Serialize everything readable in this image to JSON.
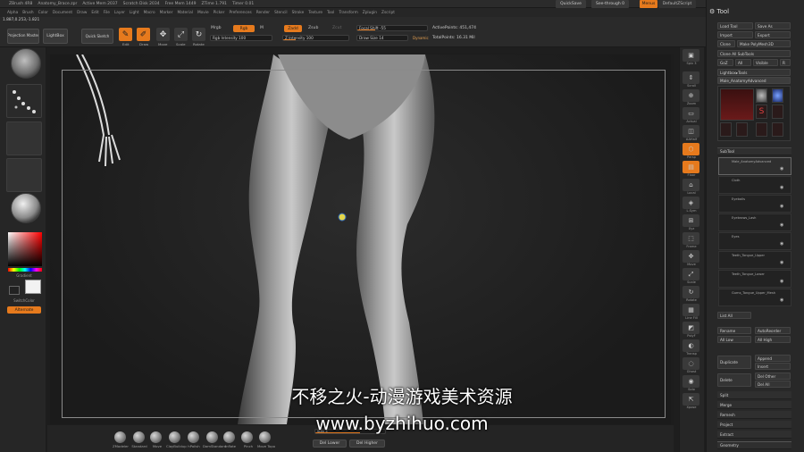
{
  "titlebar": {
    "app": "ZBrush 4R8",
    "doc": "Anatomy_Brace.zpr",
    "stats": [
      "Active Mem 2037",
      "Scratch Disk 2034",
      "Free Mem 1449",
      "ZTime 1.791",
      "Timer 0.01"
    ]
  },
  "topright": {
    "quicksave": "QuickSave",
    "seethrough": "See-through 0",
    "menus": "Menus",
    "script": "DefaultZScript"
  },
  "menubar": [
    "Alpha",
    "Brush",
    "Color",
    "Document",
    "Draw",
    "Edit",
    "File",
    "Layer",
    "Light",
    "Macro",
    "Marker",
    "Material",
    "Movie",
    "Picker",
    "Preferences",
    "Render",
    "Stencil",
    "Stroke",
    "Texture",
    "Tool",
    "Transform",
    "Zplugin",
    "Zscript"
  ],
  "coords": "1.887,0.253,-1.821",
  "toolbar": {
    "projection_master": "Projection Master",
    "lightbox": "LightBox",
    "quick_sketch": "Quick Sketch",
    "edit": "Edit",
    "draw": "Draw",
    "move": "Move",
    "scale": "Scale",
    "rotate": "Rotate",
    "mrgb": "Mrgb",
    "rgb": "Rgb",
    "m": "M",
    "zadd": "Zadd",
    "zsub": "Zsub",
    "zcut": "Zcut",
    "rgb_intensity": "Rgb Intensity 100",
    "z_intensity": "Z Intensity 100",
    "focal_shift": "Focal Shift -55",
    "draw_size": "Draw Size 14",
    "dynamic": "Dynamic",
    "active_points": "ActivePoints: 451,474",
    "total_points": "TotalPoints: 16.31 Mil"
  },
  "lefttray": {
    "labels": [
      "",
      "",
      "",
      "",
      "",
      "Gradient",
      "SwitchColor",
      "Alternate"
    ]
  },
  "subtitle": "不移之火-动漫游戏美术资源",
  "watermark": "www.byzhihuo.com",
  "bottom": {
    "brushes": [
      "ZModeler",
      "Standard",
      "Move",
      "ClayBuildup",
      "hPolish",
      "DamStandard",
      "Inflate",
      "Pinch",
      "Move Topo",
      "Clay"
    ],
    "del_lower": "Del Lower",
    "del_higher": "Del Higher",
    "subdiv": "SDiv 5"
  },
  "rightshelf": [
    "Spix 3",
    "Scroll",
    "Zoom",
    "Actual",
    "AAHalf",
    "Persp",
    "Floor",
    "Local",
    "L.Sym",
    "Xyz",
    "Frame",
    "Move",
    "Scale",
    "Rotate",
    "Line Fill",
    "PolyF",
    "Transp",
    "Ghost",
    "Solo",
    "Xpose"
  ],
  "tool": {
    "title": "Tool",
    "load_tool": "Load Tool",
    "save_as": "Save As",
    "import": "Import",
    "export": "Export",
    "clone": "Clone",
    "make_polymesh": "Make PolyMesh3D",
    "goz": "GoZ",
    "all": "All",
    "visible": "Visible",
    "r": "R",
    "clone_all": "Clone All SubTools",
    "lightbox_tools": "Lightbox▸Tools",
    "current_tool": "Male_AnatomyAdvanced",
    "subtool_header": "SubTool",
    "subtools": [
      "Male_AnatomyAdvanced",
      "Cloth",
      "Eyeballs",
      "Eyebrows_Lash",
      "Eyes",
      "Teeth_Tongue_Upper",
      "Teeth_Tongue_Lower",
      "Gums_Tongue_Upper_Mesh"
    ],
    "list_all": "List All",
    "rename": "Rename",
    "autoreorder": "AutoReorder",
    "all_low": "All Low",
    "all_high": "All High",
    "duplicate": "Duplicate",
    "append": "Append",
    "insert": "Insert",
    "delete": "Delete",
    "del_other": "Del Other",
    "del_all": "Del All",
    "split": "Split",
    "merge": "Merge",
    "remesh": "Remesh",
    "project": "Project",
    "extract": "Extract",
    "geometry": "Geometry"
  },
  "colors": {
    "accent": "#e67a1d",
    "bg": "#1e1e1e"
  }
}
